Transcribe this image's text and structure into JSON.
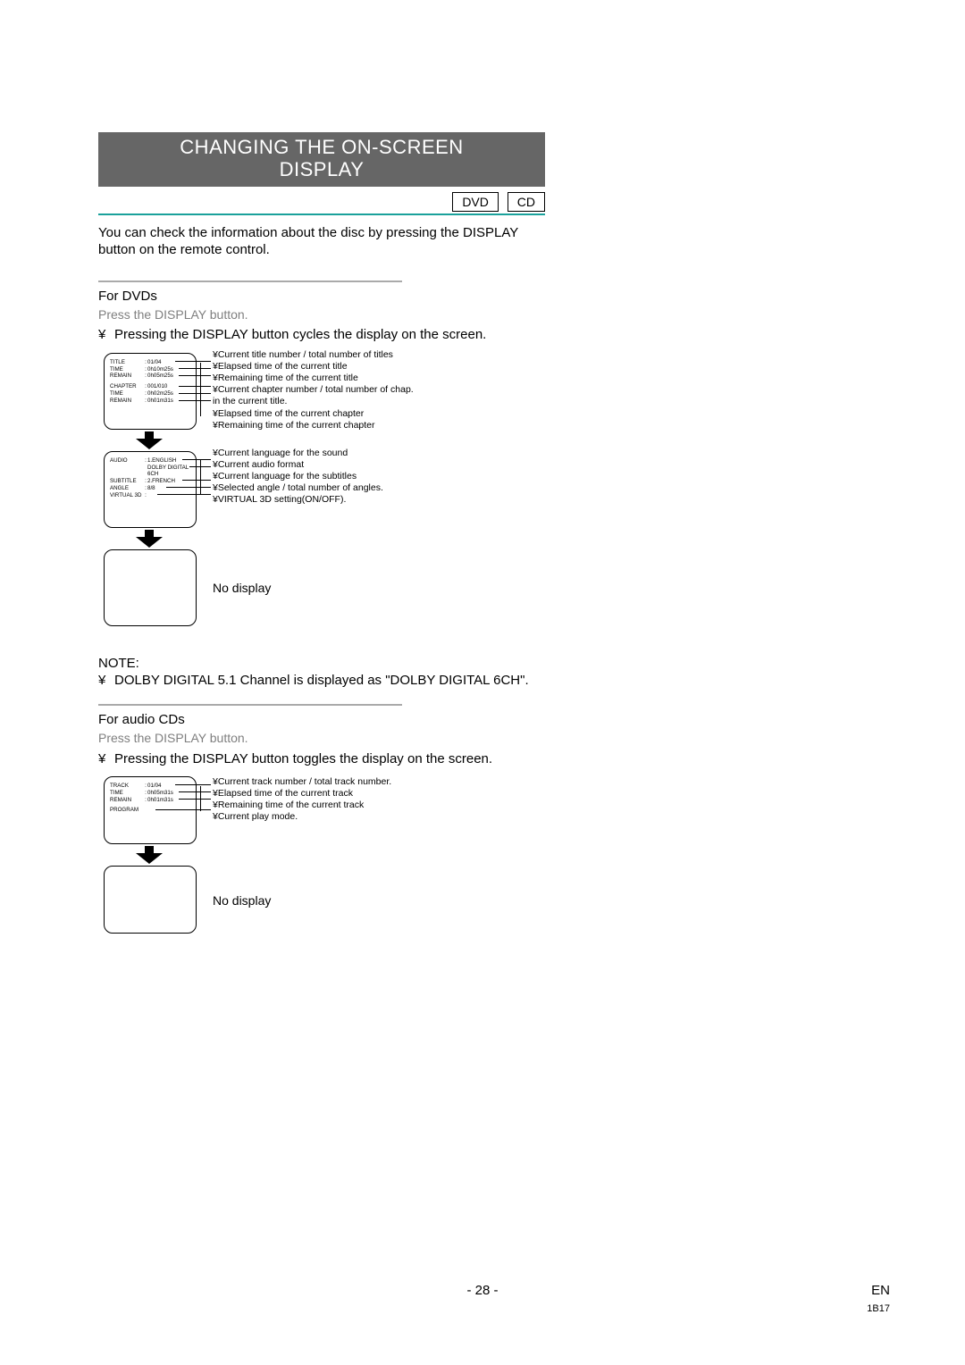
{
  "title_line1": "CHANGING THE ON-SCREEN",
  "title_line2": "DISPLAY",
  "badges": {
    "dvd": "DVD",
    "cd": "CD"
  },
  "intro": "You can check the information about the disc by pressing the DISPLAY button on the remote control.",
  "dvd": {
    "heading": "For DVDs",
    "instr": "Press the DISPLAY button.",
    "bullet_mark": "¥",
    "bullet": "Pressing the DISPLAY button cycles the display on the screen.",
    "osd1": {
      "rows": [
        {
          "lbl": "TITLE",
          "val": "01/04"
        },
        {
          "lbl": "TIME",
          "val": "0h10m25s"
        },
        {
          "lbl": "REMAIN",
          "val": "0h05m25s"
        },
        {
          "lbl": "",
          "val": ""
        },
        {
          "lbl": "CHAPTER",
          "val": "001/010"
        },
        {
          "lbl": "TIME",
          "val": "0h02m25s"
        },
        {
          "lbl": "REMAIN",
          "val": "0h01m31s"
        }
      ]
    },
    "osd1_ann": [
      "¥Current title number / total number of titles",
      "¥Elapsed time of the current title",
      "¥Remaining time of the current title",
      "¥Current chapter number / total number of chap. in the current title.",
      "¥Elapsed time of the current chapter",
      "¥Remaining time of the current chapter"
    ],
    "osd2": {
      "rows": [
        {
          "lbl": "AUDIO",
          "val": "1.ENGLISH"
        },
        {
          "lbl": "",
          "val": "DOLBY DIGITAL"
        },
        {
          "lbl": "",
          "val": "6CH"
        },
        {
          "lbl": "SUBTITLE",
          "val": "2.FRENCH"
        },
        {
          "lbl": "ANGLE",
          "val": "8/8"
        },
        {
          "lbl": "VIRTUAL 3D",
          "val": ""
        }
      ]
    },
    "osd2_ann": [
      "¥Current language for the sound",
      "¥Current audio format",
      "¥Current language for the subtitles",
      "¥Selected angle / total number of angles.",
      "¥VIRTUAL 3D setting(ON/OFF)."
    ],
    "nodisplay": "No display"
  },
  "note": {
    "heading": "NOTE:",
    "bullet_mark": "¥",
    "text": "DOLBY DIGITAL 5.1 Channel is displayed as \"DOLBY DIGITAL 6CH\"."
  },
  "cd": {
    "heading": "For audio CDs",
    "instr": "Press the DISPLAY button.",
    "bullet_mark": "¥",
    "bullet": "Pressing the DISPLAY button toggles the display on the screen.",
    "osd": {
      "rows": [
        {
          "lbl": "TRACK",
          "val": "01/04"
        },
        {
          "lbl": "TIME",
          "val": "0h05m31s"
        },
        {
          "lbl": "REMAIN",
          "val": "0h01m31s"
        },
        {
          "lbl": "",
          "val": ""
        },
        {
          "lbl": "PROGRAM",
          "val": ""
        }
      ]
    },
    "ann": [
      "¥Current track number / total track number.",
      "¥Elapsed time of the current track",
      "¥Remaining time of the current track",
      "¥Current play mode."
    ],
    "nodisplay": "No display"
  },
  "footer": {
    "page": "- 28 -",
    "lang": "EN",
    "code": "1B17"
  }
}
